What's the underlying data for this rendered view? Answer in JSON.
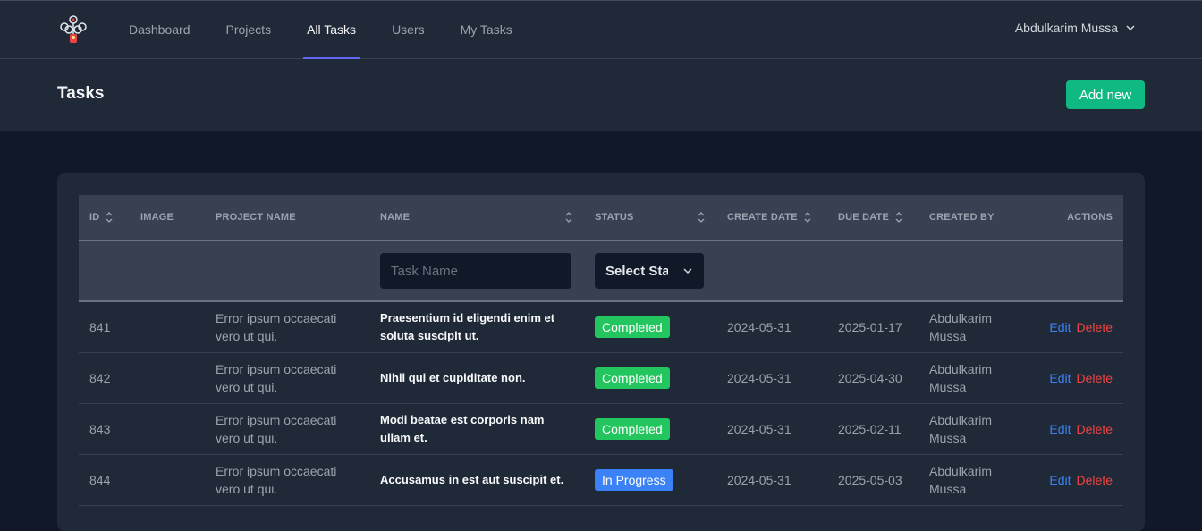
{
  "nav": {
    "items": [
      "Dashboard",
      "Projects",
      "All Tasks",
      "Users",
      "My Tasks"
    ],
    "active_index": 2,
    "user_name": "Abdulkarim Mussa"
  },
  "header": {
    "title": "Tasks",
    "add_label": "Add new"
  },
  "table": {
    "columns": {
      "id": "ID",
      "image": "IMAGE",
      "project": "PROJECT NAME",
      "name": "NAME",
      "status": "STATUS",
      "create_date": "CREATE DATE",
      "due_date": "DUE DATE",
      "created_by": "CREATED BY",
      "actions": "ACTIONS"
    },
    "filters": {
      "name_placeholder": "Task Name",
      "status_value": "Select Status"
    },
    "rows": [
      {
        "id": "841",
        "project": "Error ipsum occaecati vero ut qui.",
        "name": "Praesentium id eligendi enim et soluta suscipit ut.",
        "status": "Completed",
        "create_date": "2024-05-31",
        "due_date": "2025-01-17",
        "created_by": "Abdulkarim Mussa",
        "edit": "Edit",
        "delete": "Delete"
      },
      {
        "id": "842",
        "project": "Error ipsum occaecati vero ut qui.",
        "name": "Nihil qui et cupiditate non.",
        "status": "Completed",
        "create_date": "2024-05-31",
        "due_date": "2025-04-30",
        "created_by": "Abdulkarim Mussa",
        "edit": "Edit",
        "delete": "Delete"
      },
      {
        "id": "843",
        "project": "Error ipsum occaecati vero ut qui.",
        "name": "Modi beatae est corporis nam ullam et.",
        "status": "Completed",
        "create_date": "2024-05-31",
        "due_date": "2025-02-11",
        "created_by": "Abdulkarim Mussa",
        "edit": "Edit",
        "delete": "Delete"
      },
      {
        "id": "844",
        "project": "Error ipsum occaecati vero ut qui.",
        "name": "Accusamus in est aut suscipit et.",
        "status": "In Progress",
        "create_date": "2024-05-31",
        "due_date": "2025-05-03",
        "created_by": "Abdulkarim Mussa",
        "edit": "Edit",
        "delete": "Delete"
      }
    ]
  },
  "colors": {
    "completed": "#22c55e",
    "in_progress": "#3b82f6",
    "accent": "#6366f1",
    "add_button": "#10b981"
  }
}
